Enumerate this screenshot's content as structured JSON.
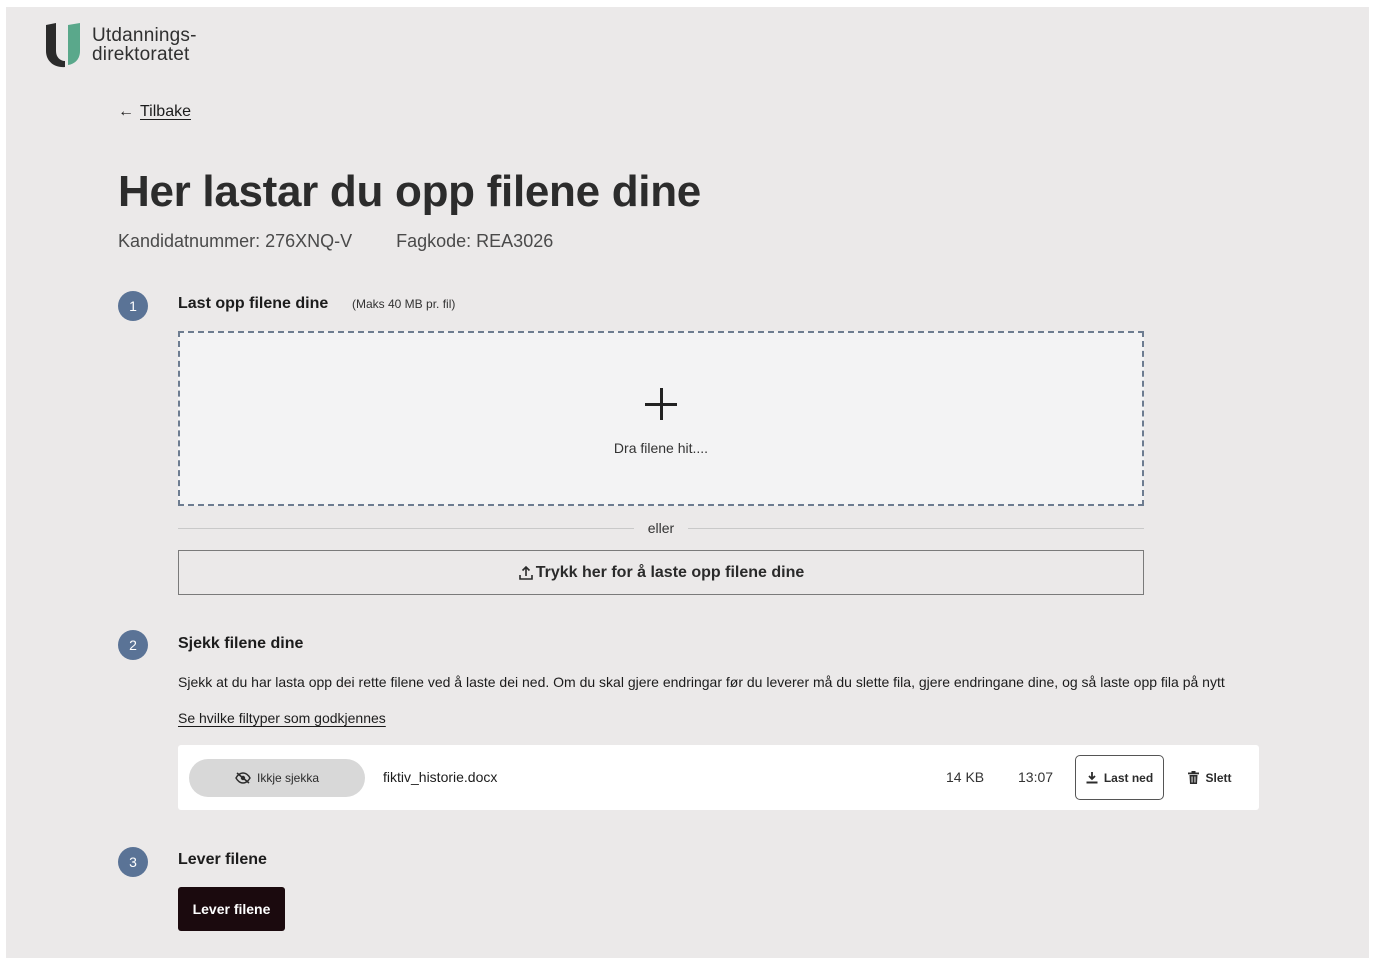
{
  "header": {
    "logo_line1": "Utdannings-",
    "logo_line2": "direktoratet",
    "logo_icon": "udir-u-logo-icon"
  },
  "nav": {
    "back_label": "Tilbake",
    "back_icon": "arrow-left-icon"
  },
  "page": {
    "title": "Her lastar du opp filene dine",
    "candidate_number": "Kandidatnummer: 276XNQ-V",
    "subject_code": "Fagkode: REA3026"
  },
  "steps": [
    {
      "number": "1",
      "title": "Last opp filene dine",
      "hint": "(Maks 40 MB pr. fil)"
    },
    {
      "number": "2",
      "title": "Sjekk filene dine",
      "instructions": "Sjekk at du har lasta opp dei rette filene ved å laste dei ned. Om du skal gjere endringar før du leverer må du slette fila, gjere endringane dine, og så laste opp fila på nytt",
      "filetypes_link": "Se hvilke filtyper som godkjennes"
    },
    {
      "number": "3",
      "title": "Lever filene"
    }
  ],
  "upload": {
    "dropzone_text": "Dra filene hit....",
    "dropzone_icon": "plus-icon",
    "divider_text": "eller",
    "button_label": "Trykk her for å laste opp filene dine",
    "button_icon": "upload-icon"
  },
  "files": [
    {
      "status": "Ikkje sjekka",
      "status_icon": "eye-off-icon",
      "name": "fiktiv_historie.docx",
      "size": "14 KB",
      "time": "13:07",
      "download_label": "Last ned",
      "download_icon": "download-icon",
      "delete_label": "Slett",
      "delete_icon": "trash-icon"
    }
  ],
  "submit": {
    "label": "Lever filene"
  },
  "colors": {
    "background": "#ebe9e9",
    "step_badge": "#5a7396",
    "submit_button": "#1b0a0e",
    "logo_dark": "#2b2b2b",
    "logo_green": "#5aa88b"
  }
}
